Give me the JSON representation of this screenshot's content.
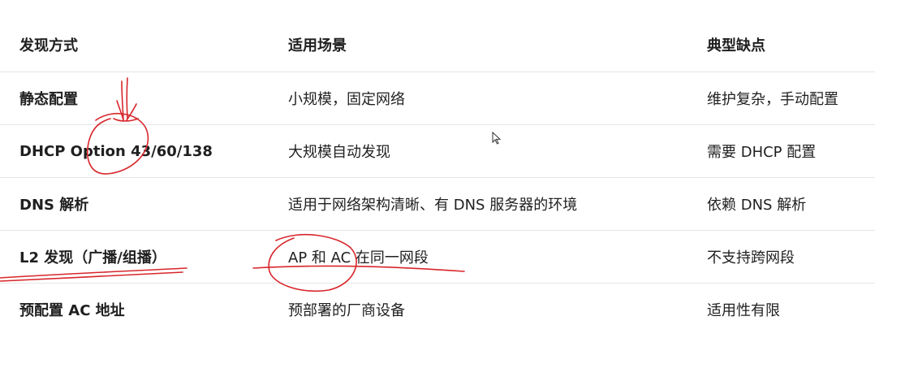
{
  "table": {
    "headers": [
      "发现方式",
      "适用场景",
      "典型缺点"
    ],
    "rows": [
      [
        "静态配置",
        "小规模，固定网络",
        "维护复杂，手动配置"
      ],
      [
        "DHCP Option 43/60/138",
        "大规模自动发现",
        "需要 DHCP 配置"
      ],
      [
        "DNS 解析",
        "适用于网络架构清晰、有 DNS 服务器的环境",
        "依赖 DNS 解析"
      ],
      [
        "L2 发现（广播/组播）",
        "AP 和 AC 在同一网段",
        "不支持跨网段"
      ],
      [
        "预配置 AC 地址",
        "预部署的厂商设备",
        "适用性有限"
      ]
    ]
  },
  "annotation_color": "#d8262b",
  "icons": {
    "cursor": "mouse-pointer-icon"
  }
}
